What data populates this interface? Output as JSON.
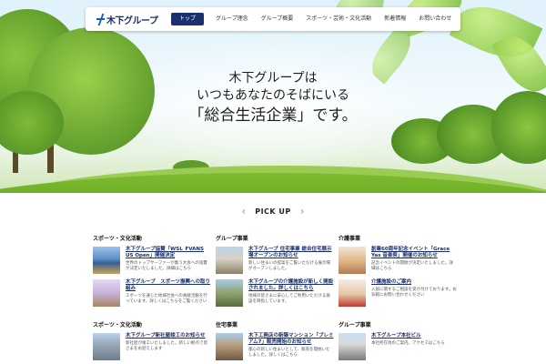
{
  "nav": {
    "logo_text": "木下グループ",
    "items": [
      "トップ",
      "グループ理念",
      "グループ概要",
      "スポーツ・芸術・文化活動",
      "新着情報",
      "お問い合わせ"
    ]
  },
  "hero": {
    "line1": "木下グループは",
    "line2": "いつもあなたのそばにいる",
    "line3": "「総合生活企業」です。"
  },
  "pickup": {
    "title": "PICK UP"
  },
  "columns": [
    {
      "category": "スポーツ・文化活動",
      "items": [
        {
          "title": "木下グループ協賛「WSL_FVANS US Open」開催決定",
          "desc": "世界のトップサーファーが集う大会への協賛が決定いたしました。詳細はこちら"
        },
        {
          "title": "木下グループ　スポーツ振興への取り組み",
          "desc": "スポーツを通じた地域社会への貢献活動を行っています。詳しくはこちらをご覧ください"
        }
      ]
    },
    {
      "category": "グループ事業",
      "items": [
        {
          "title": "木下グループ 住宅事業 総合住宅展示場オープンのお知らせ",
          "desc": "新しい住まいの提案をご覧いただける展示場がオープンしました。"
        },
        {
          "title": "木下グループの介護施設が新しく開設されました。詳しくはこちら",
          "desc": "地域の皆さまに安心してご利用いただける施設を目指しています。"
        }
      ]
    },
    {
      "category": "介護事業",
      "items": [
        {
          "title": "創業60周年記念イベント「Grace Yas 音楽祭」開催のお知らせ",
          "desc": "記念イベントの開催が決定いたしました。詳細はこちら"
        },
        {
          "title": "介護施設のご案内",
          "desc": "入居に関するご相談を受け付けております。お気軽にお問い合わせください"
        }
      ]
    },
    {
      "category": "スポーツ・文化活動",
      "items": [
        {
          "title": "木下グループ新社屋竣工のお知らせ",
          "desc": "新社屋が竣工いたしました。新しい拠点で皆さまをお迎えします"
        }
      ]
    },
    {
      "category": "住宅事業",
      "items": [
        {
          "title": "木下工務店の新築マンション「プレミアム7」販売開始のお知らせ",
          "desc": "都心の新しい住まいとして、販売を開始いたしました。詳しくはこちら"
        }
      ]
    },
    {
      "category": "グループ事業",
      "items": [
        {
          "title": "木下グループ本社ビル",
          "desc": "本社所在地のご案内。アクセスはこちら"
        }
      ]
    }
  ],
  "colors": {
    "brand": "#1a2f6b",
    "accent": "#1b5fb0",
    "grass": "#6fb82a"
  },
  "icons": [
    "chevron-left-icon",
    "chevron-right-icon",
    "logo-mark-icon"
  ]
}
